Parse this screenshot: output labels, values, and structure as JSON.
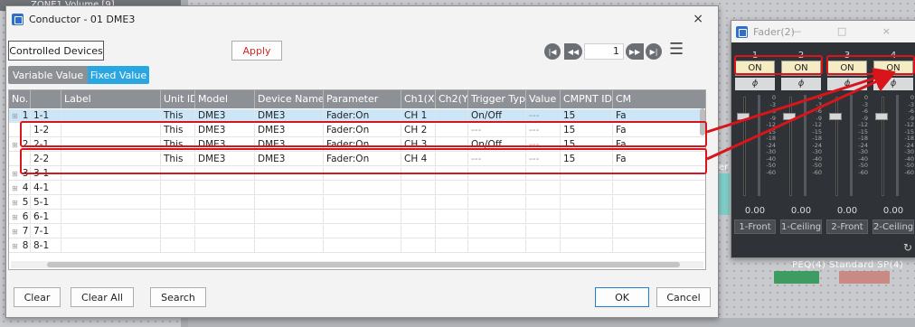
{
  "background": {
    "window_title": "ZONE1 Volume [9]",
    "er_label": "er",
    "component_label": "PEQ(4)  Standard SP(4)"
  },
  "dialog": {
    "title": "Conductor - 01 DME3",
    "close": "×",
    "controlled_devices_label": "Controlled Devices",
    "apply_label": "Apply",
    "tabs": {
      "variable": "Variable Value",
      "fixed": "Fixed Value"
    },
    "pager": {
      "first": "|◀",
      "prev": "◀◀",
      "page": "1",
      "next": "▶▶",
      "last": "▶|",
      "menu": "☰"
    },
    "table": {
      "headers": [
        "No.",
        "",
        "Label",
        "Unit ID",
        "Model",
        "Device Name",
        "Parameter",
        "Ch1(X)",
        "Ch2(Y)",
        "Trigger Type",
        "Value",
        "CMPNT ID",
        "CM"
      ],
      "rows": [
        {
          "no": "1",
          "sub": "1-1",
          "label": "",
          "unit": "This",
          "model": "DME3",
          "device": "DME3",
          "param": "Fader:On",
          "ch1": "CH 1",
          "ch2": "",
          "trigger": "On/Off",
          "value": "---",
          "cmpnt": "15",
          "cm": "Fa",
          "selected": true
        },
        {
          "no": "",
          "sub": "1-2",
          "label": "",
          "unit": "This",
          "model": "DME3",
          "device": "DME3",
          "param": "Fader:On",
          "ch1": "CH 2",
          "ch2": "",
          "trigger": "---",
          "value": "---",
          "cmpnt": "15",
          "cm": "Fa",
          "selected": false
        },
        {
          "no": "2",
          "sub": "2-1",
          "label": "",
          "unit": "This",
          "model": "DME3",
          "device": "DME3",
          "param": "Fader:On",
          "ch1": "CH 3",
          "ch2": "",
          "trigger": "On/Off",
          "value": "---",
          "cmpnt": "15",
          "cm": "Fa",
          "selected": false
        },
        {
          "no": "",
          "sub": "2-2",
          "label": "",
          "unit": "This",
          "model": "DME3",
          "device": "DME3",
          "param": "Fader:On",
          "ch1": "CH 4",
          "ch2": "",
          "trigger": "---",
          "value": "---",
          "cmpnt": "15",
          "cm": "Fa",
          "selected": false
        },
        {
          "no": "3",
          "sub": "3-1"
        },
        {
          "no": "4",
          "sub": "4-1"
        },
        {
          "no": "5",
          "sub": "5-1"
        },
        {
          "no": "6",
          "sub": "6-1"
        },
        {
          "no": "7",
          "sub": "7-1"
        },
        {
          "no": "8",
          "sub": "8-1"
        }
      ]
    },
    "buttons": {
      "clear": "Clear",
      "clear_all": "Clear All",
      "search": "Search",
      "ok": "OK",
      "cancel": "Cancel"
    }
  },
  "fader": {
    "title": "Fader(2)",
    "controls": "—  □  ×",
    "channels": [
      {
        "num": "1",
        "on": "ON",
        "phase": "ϕ",
        "value": "0.00",
        "name": "1-Front"
      },
      {
        "num": "2",
        "on": "ON",
        "phase": "ϕ",
        "value": "0.00",
        "name": "1-Ceiling"
      },
      {
        "num": "3",
        "on": "ON",
        "phase": "ϕ",
        "value": "0.00",
        "name": "2-Front"
      },
      {
        "num": "4",
        "on": "ON",
        "phase": "ϕ",
        "value": "0.00",
        "name": "2-Ceiling"
      }
    ],
    "scale": [
      "0",
      "-3",
      "-6",
      "-9",
      "-12",
      "-15",
      "-18",
      "-24",
      "-30",
      "-40",
      "-50",
      "-60"
    ],
    "refresh": "↻"
  },
  "colors": {
    "accent_red": "#d7151b",
    "tab_blue": "#2aa7e0",
    "header_gray": "#8d9196"
  }
}
